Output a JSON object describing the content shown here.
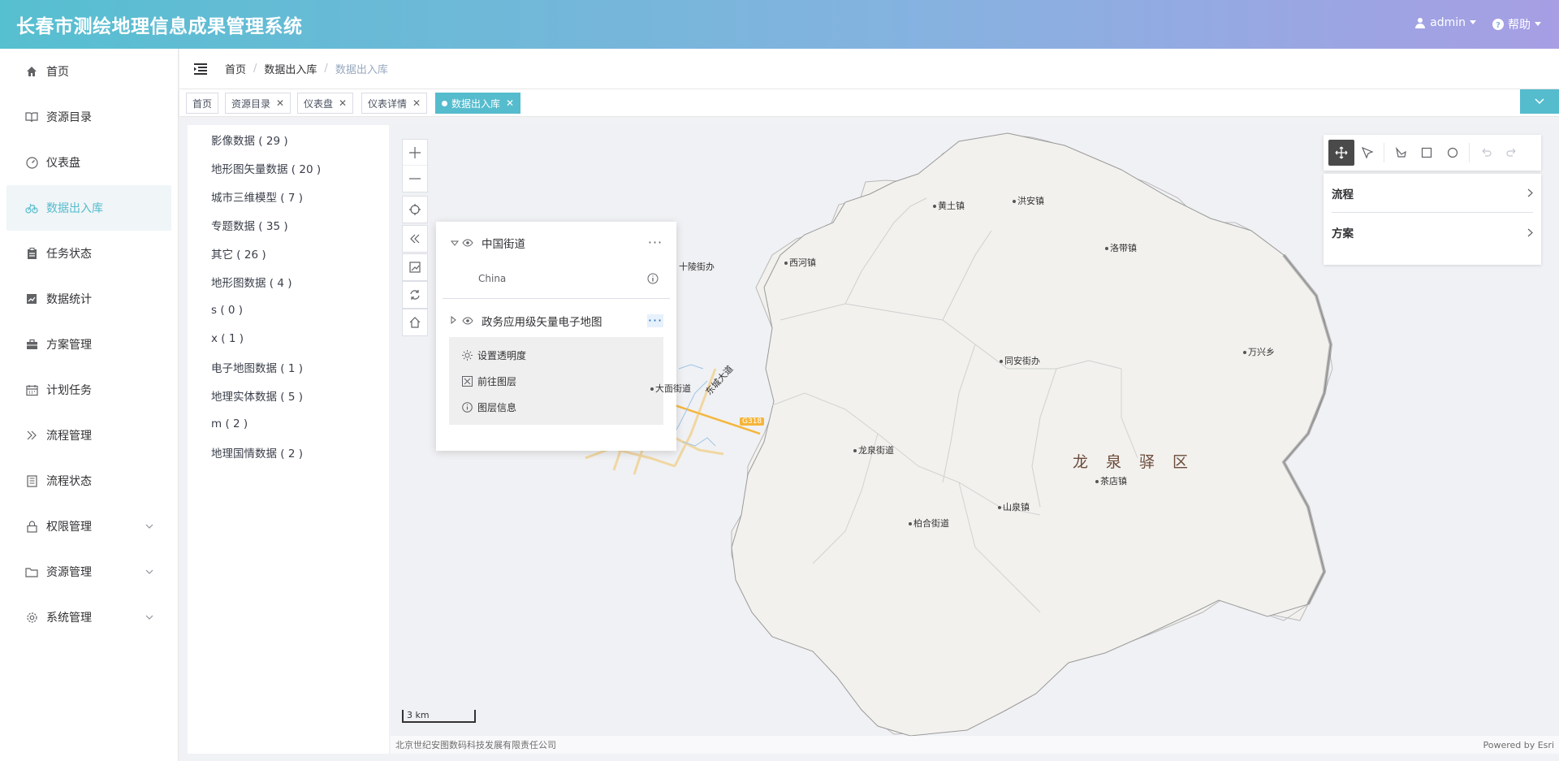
{
  "header": {
    "title": "长春市测绘地理信息成果管理系统",
    "user": "admin",
    "help": "帮助",
    "colors": {
      "start": "#56bfd0",
      "end": "#a79ee4"
    }
  },
  "sidebar": {
    "items": [
      {
        "label": "首页",
        "icon": "home-icon"
      },
      {
        "label": "资源目录",
        "icon": "book-icon"
      },
      {
        "label": "仪表盘",
        "icon": "dashboard-icon"
      },
      {
        "label": "数据出入库",
        "icon": "bike-icon",
        "active": true
      },
      {
        "label": "任务状态",
        "icon": "clipboard-icon"
      },
      {
        "label": "数据统计",
        "icon": "chart-icon"
      },
      {
        "label": "方案管理",
        "icon": "briefcase-icon"
      },
      {
        "label": "计划任务",
        "icon": "calendar-icon"
      },
      {
        "label": "流程管理",
        "icon": "double-chevron-icon"
      },
      {
        "label": "流程状态",
        "icon": "document-icon"
      },
      {
        "label": "权限管理",
        "icon": "lock-icon",
        "expandable": true
      },
      {
        "label": "资源管理",
        "icon": "folder-icon",
        "expandable": true
      },
      {
        "label": "系统管理",
        "icon": "gear-icon",
        "expandable": true
      }
    ]
  },
  "breadcrumb": [
    "首页",
    "数据出入库",
    "数据出入库"
  ],
  "tags": [
    {
      "label": "首页",
      "closable": false
    },
    {
      "label": "资源目录",
      "closable": true
    },
    {
      "label": "仪表盘",
      "closable": true
    },
    {
      "label": "仪表详情",
      "closable": true
    },
    {
      "label": "数据出入库",
      "closable": true,
      "active": true
    }
  ],
  "tree": [
    "影像数据 ( 29 )",
    "地形图矢量数据 ( 20 )",
    "城市三维模型 ( 7 )",
    "专题数据 ( 35 )",
    "其它 ( 26 )",
    "地形图数据 ( 4 )",
    "s ( 0 )",
    "x ( 1 )",
    "电子地图数据 ( 1 )",
    "地理实体数据 ( 5 )",
    "m ( 2 )",
    "地理国情数据 ( 2 )"
  ],
  "layers": {
    "layer1": {
      "name": "中国街道",
      "sub": "China"
    },
    "layer2": {
      "name": "政务应用级矢量电子地图"
    },
    "menu": [
      "设置透明度",
      "前往图层",
      "图层信息"
    ]
  },
  "panel": {
    "rows": [
      "流程",
      "方案"
    ]
  },
  "map": {
    "district": "龙泉驿区",
    "places": [
      "黄土镇",
      "洪安镇",
      "西河镇",
      "十陵街办",
      "洛带镇",
      "万兴乡",
      "同安街办",
      "大面街道",
      "东城大道",
      "龙泉街道",
      "茶店镇",
      "山泉镇",
      "柏合街道"
    ],
    "road_badge": "G318",
    "scale": "3 km",
    "attribution_left": "北京世纪安图数码科技发展有限责任公司",
    "attribution_right": "Powered by Esri"
  }
}
